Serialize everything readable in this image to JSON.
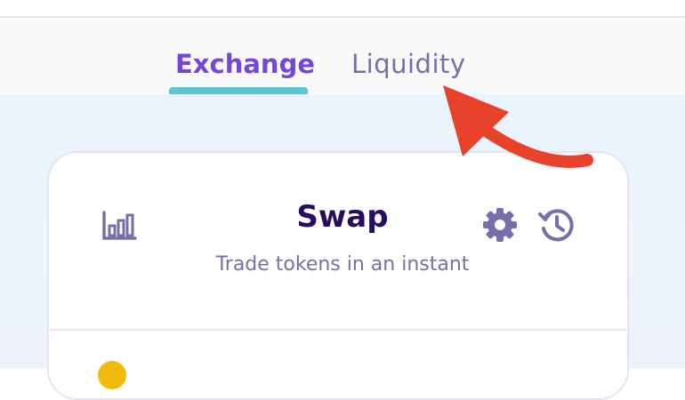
{
  "nav": {
    "tabs": [
      {
        "label": "Exchange",
        "active": true
      },
      {
        "label": "Liquidity",
        "active": false
      }
    ]
  },
  "swap_card": {
    "title": "Swap",
    "subtitle": "Trade tokens in an instant",
    "icons": [
      "chart-icon",
      "gear-icon",
      "history-icon"
    ]
  },
  "colors": {
    "accent": "#7645d9",
    "secondary_text": "#7a6eaa",
    "title_text": "#280d5f",
    "tab_indicator": "#5dc6d2",
    "annotation_arrow": "#e8422a"
  }
}
